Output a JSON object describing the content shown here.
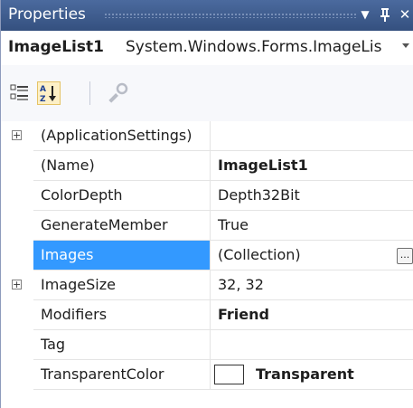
{
  "window": {
    "title": "Properties",
    "pin_glyph": "▼",
    "autohide_glyph": "ᵖ",
    "close_glyph": "✕"
  },
  "object_selector": {
    "name": "ImageList1",
    "type": "System.Windows.Forms.ImageLis"
  },
  "toolbar": {
    "buttons": [
      {
        "name": "categorized-icon",
        "active": false
      },
      {
        "name": "alphabetical-icon",
        "active": true
      },
      {
        "name": "property-pages-icon",
        "active": false
      }
    ]
  },
  "properties": [
    {
      "name": "(ApplicationSettings)",
      "value": "",
      "expandable": true,
      "expand_glyph": "+"
    },
    {
      "name": "(Name)",
      "value": "ImageList1",
      "bold": true
    },
    {
      "name": "ColorDepth",
      "value": "Depth32Bit"
    },
    {
      "name": "GenerateMember",
      "value": "True"
    },
    {
      "name": "Images",
      "value": "(Collection)",
      "selected": true,
      "ellipsis": "..."
    },
    {
      "name": "ImageSize",
      "value": "32, 32",
      "expandable": true,
      "expand_glyph": "+"
    },
    {
      "name": "Modifiers",
      "value": "Friend",
      "bold": true
    },
    {
      "name": "Tag",
      "value": ""
    },
    {
      "name": "TransparentColor",
      "value": "Transparent",
      "bold": true,
      "swatch_color": "#ffffff"
    }
  ],
  "colors": {
    "titlebar": "#3d5a8c",
    "selection": "#3399ff"
  }
}
